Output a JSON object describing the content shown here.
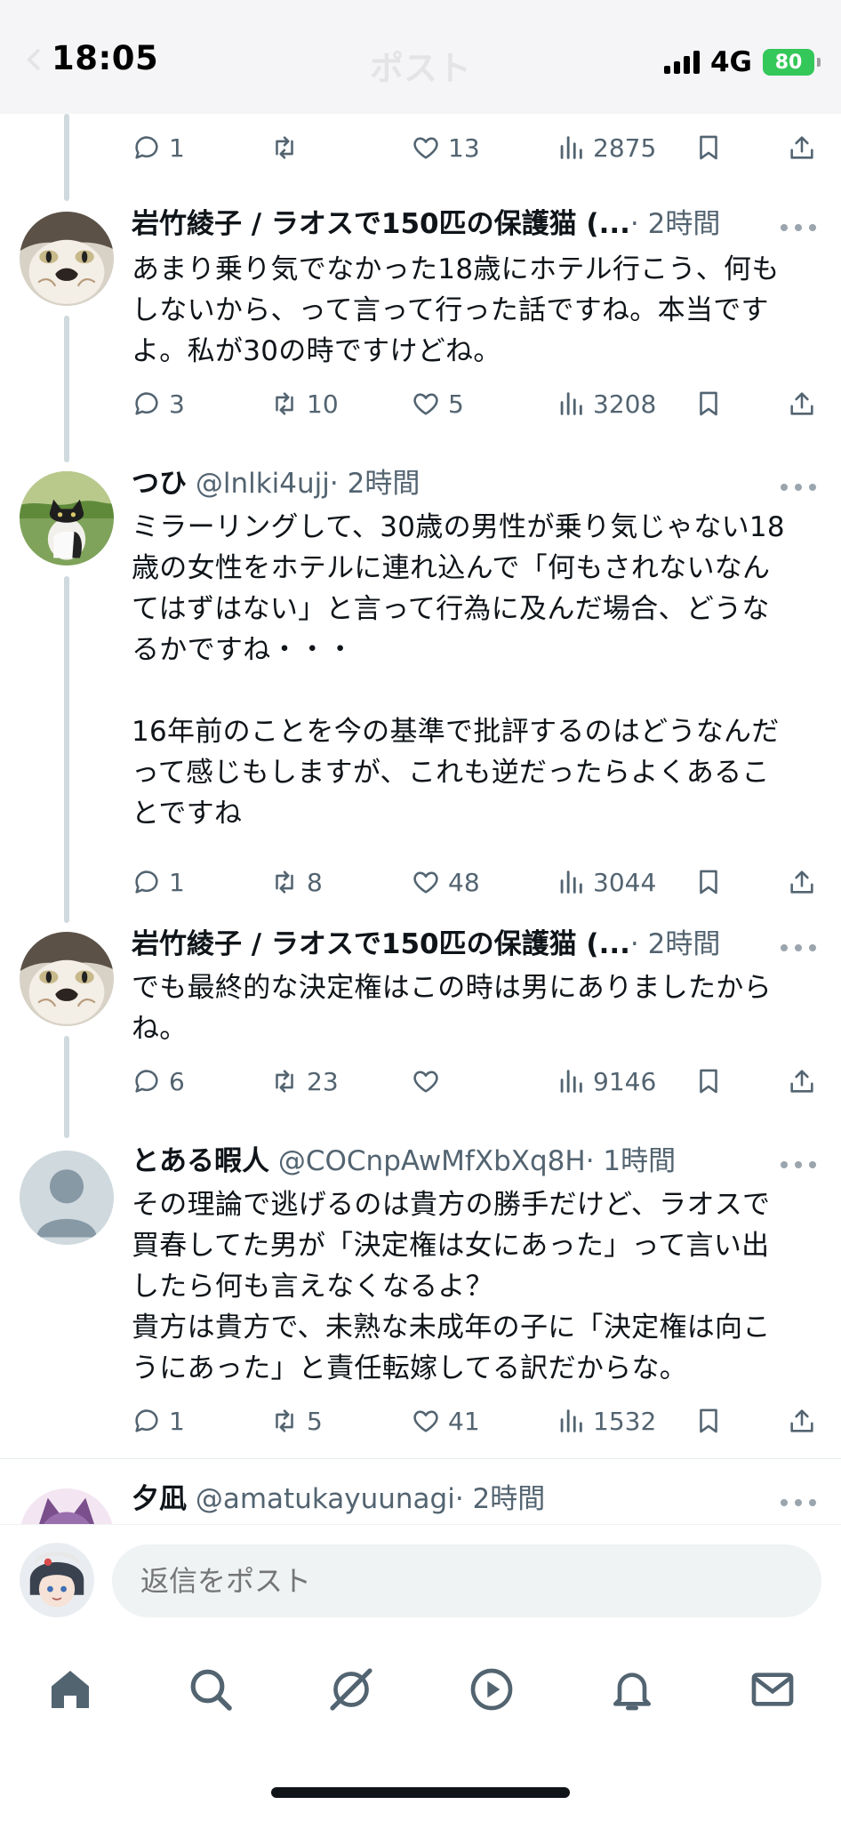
{
  "status_bar": {
    "time": "18:05",
    "network": "4G",
    "battery": "80"
  },
  "header": {
    "title": "ポスト"
  },
  "prev_actions": {
    "reply": "1",
    "retweet": "",
    "like": "13",
    "views": "2875"
  },
  "posts": [
    {
      "name": "岩竹綾子 / ラオスで150匹の保護猫 (...",
      "handle": "",
      "time": "· 2時間",
      "text": "あまり乗り気でなかった18歳にホテル行こう、何もしないから、って言って行った話ですね。本当ですよ。私が30の時ですけどね。",
      "replies": "3",
      "retweets": "10",
      "likes": "5",
      "views": "3208",
      "avatar": "cat-tabby"
    },
    {
      "name": "つひ",
      "handle": "@lnlki4ujj",
      "time": "· 2時間",
      "text": "ミラーリングして、30歳の男性が乗り気じゃない18歳の女性をホテルに連れ込んで「何もされないなんてはずはない」と言って行為に及んだ場合、どうなるかですね・・・\n\n16年前のことを今の基準で批評するのはどうなんだって感じもしますが、これも逆だったらよくあることですね",
      "replies": "1",
      "retweets": "8",
      "likes": "48",
      "views": "3044",
      "avatar": "cat-field"
    },
    {
      "name": "岩竹綾子 / ラオスで150匹の保護猫 (...",
      "handle": "",
      "time": "· 2時間",
      "text": "でも最終的な決定権はこの時は男にありましたからね。",
      "replies": "6",
      "retweets": "23",
      "likes": "",
      "views": "9146",
      "avatar": "cat-tabby"
    },
    {
      "name": "とある暇人",
      "handle": "@COCnpAwMfXbXq8H",
      "time": "· 1時間",
      "text": "その理論で逃げるのは貴方の勝手だけど、ラオスで買春してた男が「決定権は女にあった」って言い出したら何も言えなくなるよ？\n貴方は貴方で、未熟な未成年の子に「決定権は向こうにあった」と責任転嫁してる訳だからな。",
      "replies": "1",
      "retweets": "5",
      "likes": "41",
      "views": "1532",
      "avatar": "default"
    },
    {
      "name": "夕凪",
      "handle": "@amatukayuunagi",
      "time": "· 2時間",
      "text": "",
      "avatar": "anime"
    }
  ],
  "reply_bar": {
    "placeholder": "返信をポスト"
  },
  "tabs": [
    "home",
    "search",
    "grok",
    "video",
    "notifications",
    "messages"
  ],
  "colors": {
    "text": "#0f1419",
    "secondary": "#536471",
    "battery": "#34c759",
    "thread_line": "#cfd9de"
  }
}
